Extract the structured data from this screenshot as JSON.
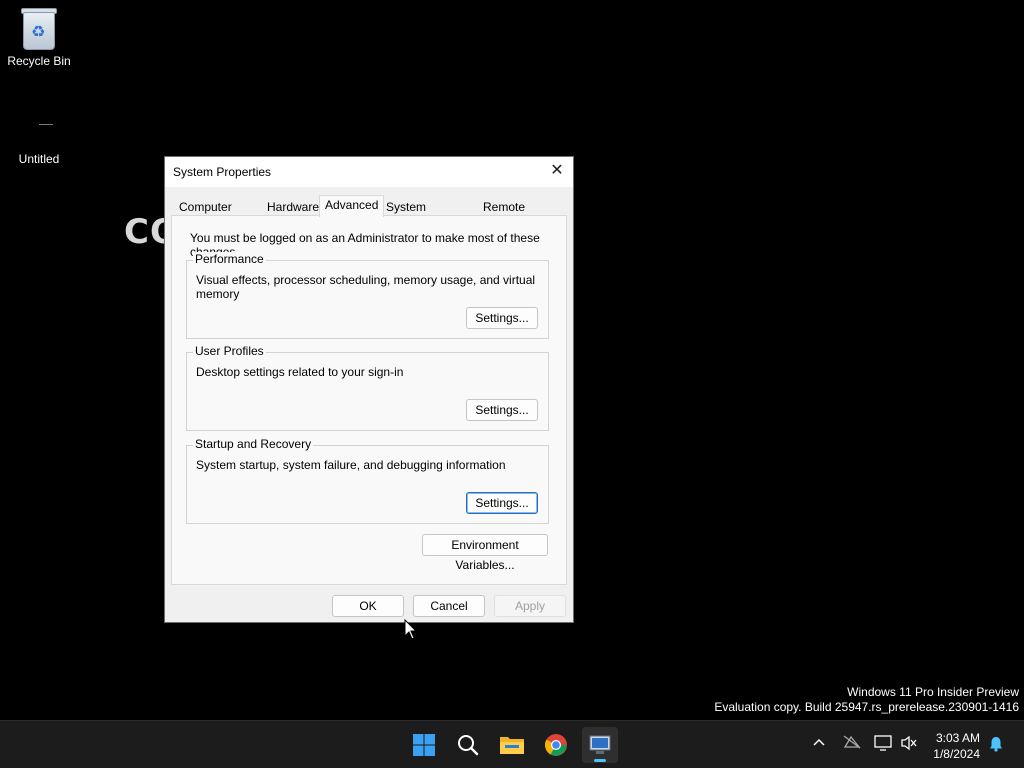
{
  "desktop": {
    "icons": [
      {
        "label": "Recycle Bin"
      },
      {
        "label": "Untitled"
      }
    ],
    "background_text": "CO"
  },
  "dialog": {
    "title": "System Properties",
    "close_glyph": "✕",
    "tabs": [
      "Computer Name",
      "Hardware",
      "Advanced",
      "System Protection",
      "Remote"
    ],
    "active_tab": "Advanced",
    "admin_note": "You must be logged on as an Administrator to make most of these changes.",
    "groups": [
      {
        "title": "Performance",
        "description": "Visual effects, processor scheduling, memory usage, and virtual memory",
        "button": "Settings..."
      },
      {
        "title": "User Profiles",
        "description": "Desktop settings related to your sign-in",
        "button": "Settings..."
      },
      {
        "title": "Startup and Recovery",
        "description": "System startup, system failure, and debugging information",
        "button": "Settings..."
      }
    ],
    "env_button": "Environment Variables...",
    "ok": "OK",
    "cancel": "Cancel",
    "apply": "Apply"
  },
  "watermark": {
    "line1": "Windows 11 Pro Insider Preview",
    "line2": "Evaluation copy. Build 25947.rs_prerelease.230901-1416"
  },
  "taskbar": {
    "apps": [
      "start-icon",
      "search-icon",
      "file-explorer-icon",
      "chrome-icon",
      "system-properties-icon"
    ],
    "clock_time": "3:03 AM",
    "clock_date": "1/8/2024",
    "tray": [
      "chevron-up-icon",
      "network-offline-icon",
      "display-icon",
      "volume-muted-icon",
      "notification-bell-icon"
    ]
  },
  "colors": {
    "accent": "#1f6fc9",
    "taskbar_bg": "#1c1c1c",
    "dialog_bg": "#f0f0f0"
  }
}
